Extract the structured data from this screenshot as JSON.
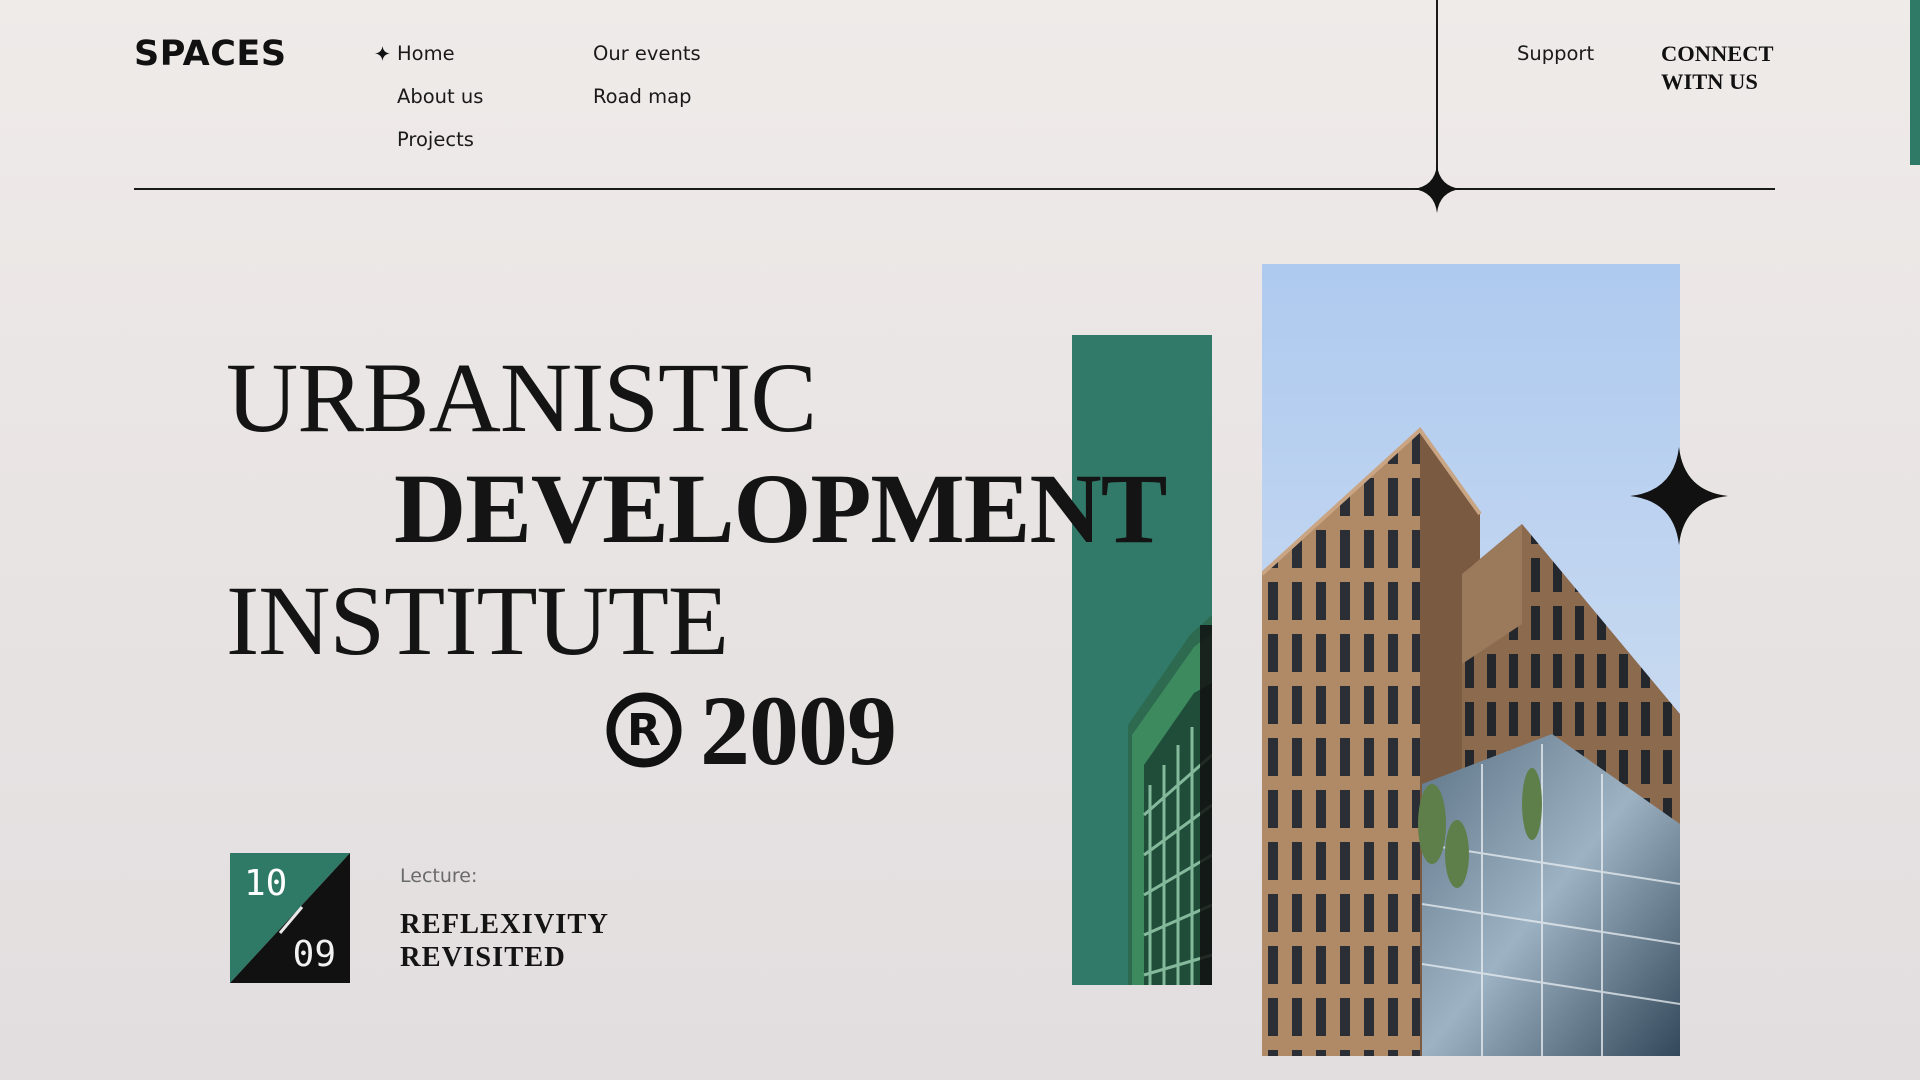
{
  "brand": {
    "logo": "SPACES"
  },
  "nav": {
    "col1": [
      "Home",
      "About us",
      "Projects"
    ],
    "col2": [
      "Our events",
      "Road map"
    ],
    "active": "Home"
  },
  "header_right": {
    "support": "Support",
    "connect": "CONNECT WITN US"
  },
  "hero": {
    "line1": "URBANISTIC",
    "line2": "DEVELOPMENT",
    "line3": "INSTITUTE",
    "year": "2009",
    "registered_icon": "registered-icon"
  },
  "event": {
    "day": "10",
    "month": "09",
    "label": "Lecture:",
    "title": "REFLEXIVITY REVISITED"
  },
  "colors": {
    "accent_green": "#317a69",
    "ink": "#121212",
    "background": "#ece8e7"
  },
  "icons": [
    "four-point-star-icon",
    "registered-icon"
  ]
}
